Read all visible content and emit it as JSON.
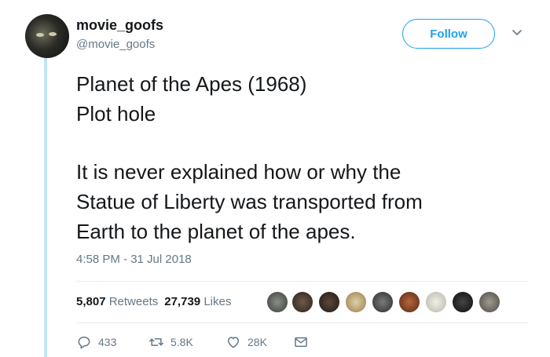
{
  "tweet": {
    "display_name": "movie_goofs",
    "handle": "@movie_goofs",
    "follow_label": "Follow",
    "text_lines": [
      "Planet of the Apes (1968)",
      "Plot hole",
      "It is never explained how or why the",
      "Statue of Liberty was transported from",
      "Earth to the planet of the apes."
    ],
    "timestamp": "4:58 PM - 31 Jul 2018",
    "stats": {
      "retweets_count": "5,807",
      "retweets_label": "Retweets",
      "likes_count": "27,739",
      "likes_label": "Likes"
    },
    "actions": {
      "replies": "433",
      "retweets": "5.8K",
      "likes": "28K"
    }
  },
  "colors": {
    "accent": "#1da1f2",
    "secondary_text": "#657786",
    "thread_line": "#c4e4f7"
  },
  "liker_avatars": [
    "avatar-1",
    "avatar-2",
    "avatar-3",
    "avatar-4",
    "avatar-5",
    "avatar-6",
    "avatar-7",
    "avatar-8",
    "avatar-9"
  ]
}
